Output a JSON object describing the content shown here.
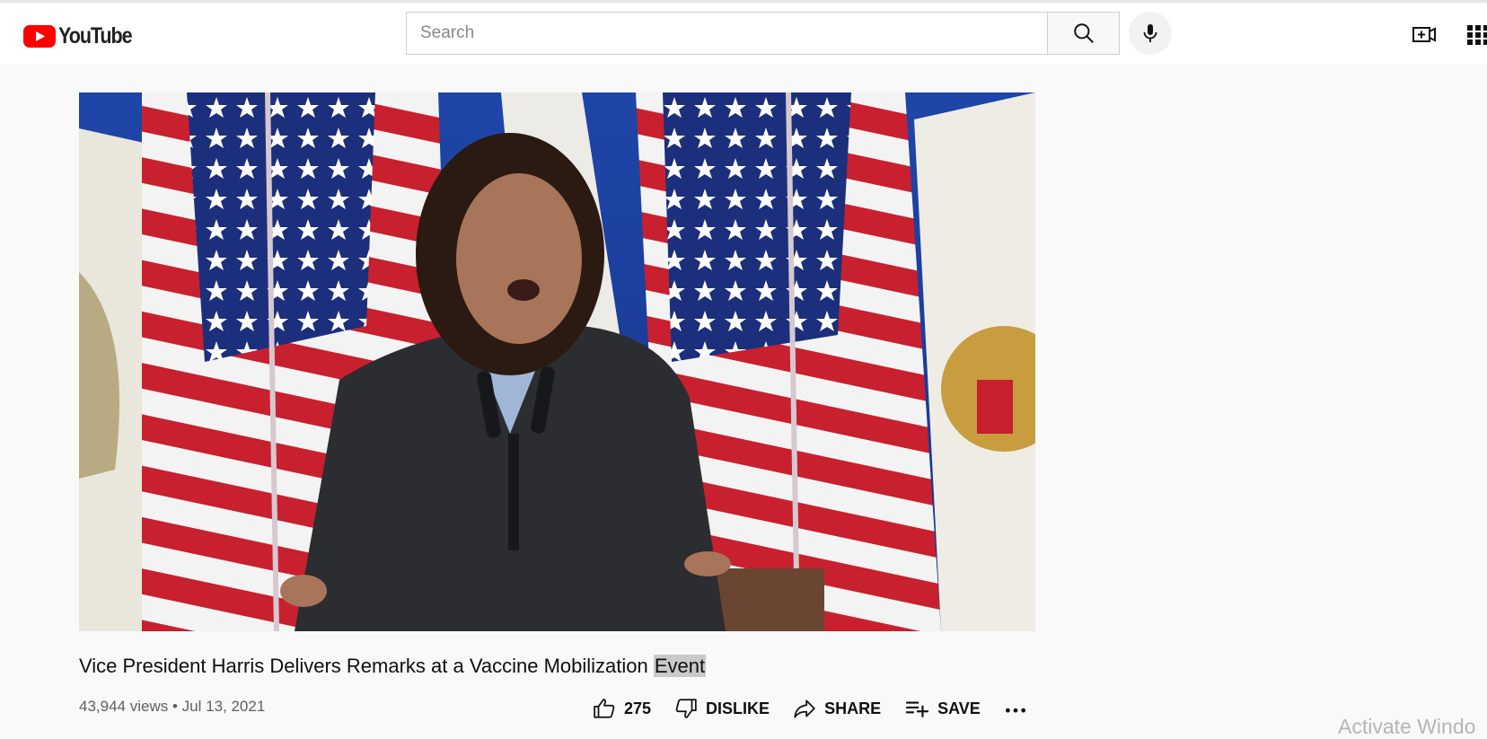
{
  "header": {
    "logo_text": "YouTube",
    "search_placeholder": "Search",
    "icons": [
      "youtube-logo-icon",
      "search-icon",
      "microphone-icon",
      "create-video-icon",
      "apps-grid-icon"
    ]
  },
  "video": {
    "title_main": "Vice President Harris Delivers Remarks at a Vaccine Mobilization ",
    "title_highlight": "Event",
    "views": "43,944 views",
    "separator": "•",
    "date": "Jul 13, 2021"
  },
  "actions": {
    "like_count": "275",
    "dislike_label": "DISLIKE",
    "share_label": "SHARE",
    "save_label": "SAVE"
  },
  "overlay": {
    "watermark": "Activate Windo"
  },
  "colors": {
    "brand_red": "#ff0000",
    "background": "#f9f9f9",
    "text_primary": "#0f0f0f",
    "text_secondary": "#606060"
  }
}
